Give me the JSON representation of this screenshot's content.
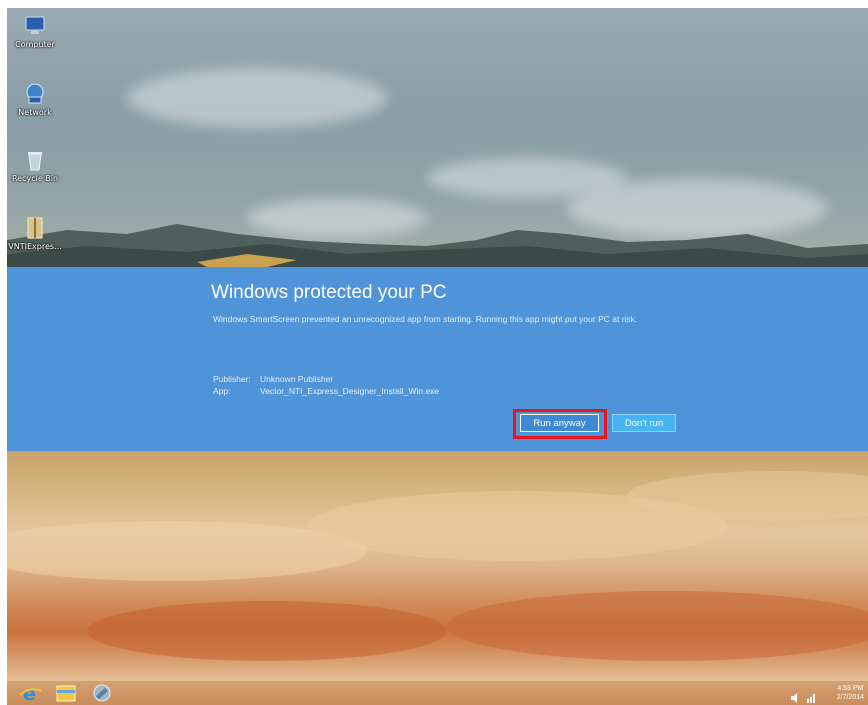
{
  "desktop": {
    "icons": [
      {
        "label": "Computer",
        "icon": "computer-icon"
      },
      {
        "label": "Network",
        "icon": "network-icon"
      },
      {
        "label": "Recycle Bin",
        "icon": "recycle-bin-icon"
      },
      {
        "label": "VNTIExpres...",
        "icon": "installer-file-icon"
      }
    ]
  },
  "smartscreen": {
    "title": "Windows protected your PC",
    "message": "Windows SmartScreen prevented an unrecognized app from starting. Running this app might put your PC at risk.",
    "publisher_key": "Publisher:",
    "publisher_value": "Unknown Publisher",
    "app_key": "App:",
    "app_value": "Vector_NTI_Express_Designer_Install_Win.exe",
    "run_anyway_label": "Run anyway",
    "dont_run_label": "Don't run",
    "background_color": "#4f93d8",
    "highlight_color": "#e8141e"
  },
  "taskbar": {
    "pinned": [
      "internet-explorer-icon",
      "file-explorer-icon",
      "installer-icon"
    ],
    "tray": {
      "icons": [
        "volume-icon",
        "network-tray-icon"
      ],
      "time": "4:53 PM",
      "date": "2/7/2014"
    }
  }
}
